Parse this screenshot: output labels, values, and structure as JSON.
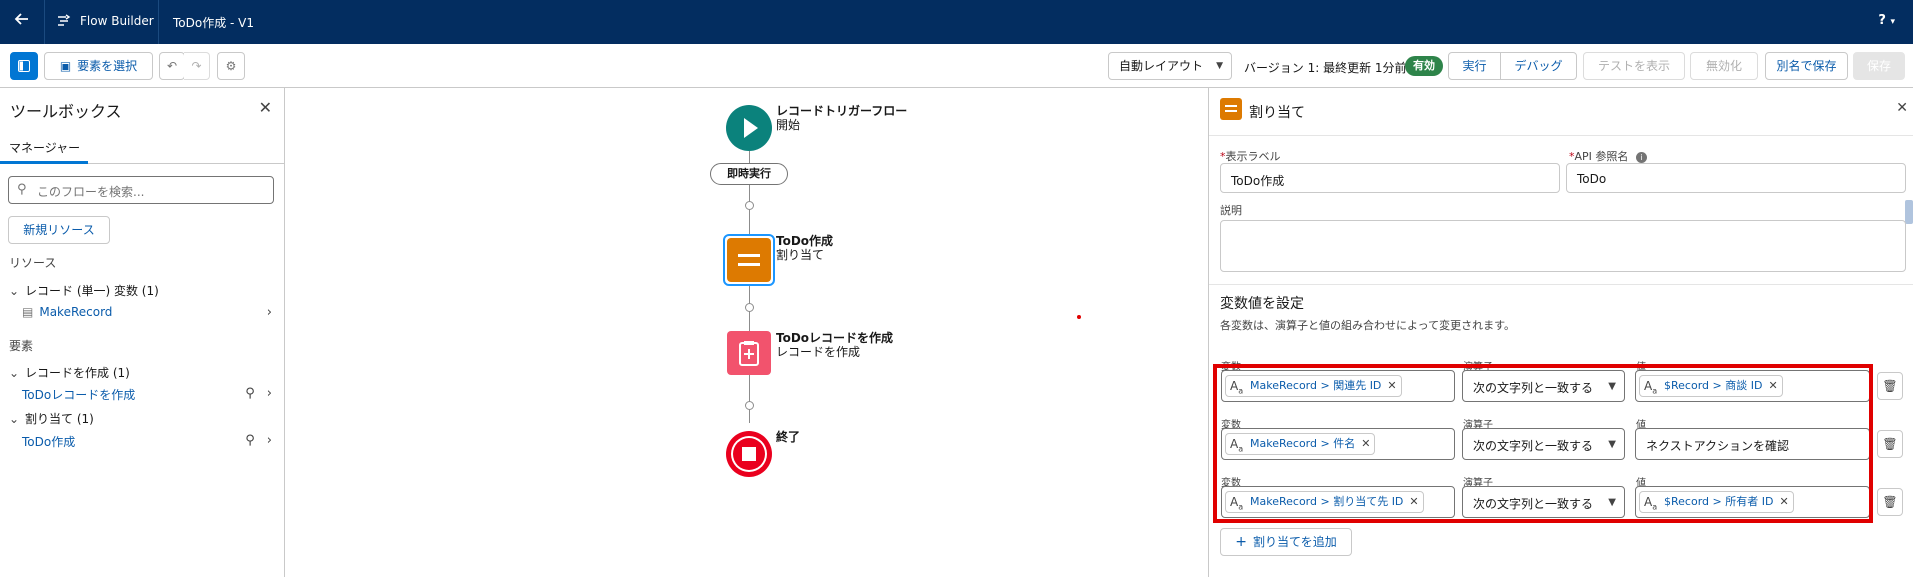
{
  "header": {
    "back_icon": "back-arrow-icon",
    "app_icon": "flow-builder-icon",
    "app_title": "Flow Builder",
    "flow_name": "ToDo作成 - V1",
    "help": "?",
    "help_caret": "▾"
  },
  "toolbar": {
    "select_elements": "要素を選択",
    "layout_select": "自動レイアウト",
    "version_text": "バージョン 1: 最終更新 1分前",
    "status_badge": "有効",
    "run": "実行",
    "debug": "デバッグ",
    "view_tests": "テストを表示",
    "deactivate": "無効化",
    "save_as": "別名で保存",
    "save": "保存"
  },
  "toolbox": {
    "title": "ツールボックス",
    "tab": "マネージャー",
    "search_placeholder": "このフローを検索...",
    "new_resource": "新規リソース",
    "resources_heading": "リソース",
    "record_var_group": "レコード (単一) 変数 (1)",
    "record_var_item": "MakeRecord",
    "elements_heading": "要素",
    "create_group": "レコードを作成 (1)",
    "create_item": "ToDoレコードを作成",
    "assign_group": "割り当て (1)",
    "assign_item": "ToDo作成"
  },
  "canvas": {
    "start_title": "レコードトリガーフロー",
    "start_sub": "開始",
    "run_immediately": "即時実行",
    "assign_title": "ToDo作成",
    "assign_sub": "割り当て",
    "create_title": "ToDoレコードを作成",
    "create_sub": "レコードを作成",
    "end_title": "終了"
  },
  "panel": {
    "title": "割り当て",
    "label_caption": "表示ラベル",
    "label_value": "ToDo作成",
    "api_caption": "API 参照名",
    "api_value": "ToDo",
    "desc_caption": "説明",
    "section_title": "変数値を設定",
    "section_help": "各変数は、演算子と値の組み合わせによって変更されます。",
    "col_variable": "変数",
    "col_operator": "演算子",
    "col_value": "値",
    "rows": [
      {
        "variable": "MakeRecord > 関連先 ID",
        "operator": "次の文字列と一致する",
        "value": "$Record > 商談 ID",
        "value_is_chip": true
      },
      {
        "variable": "MakeRecord > 件名",
        "operator": "次の文字列と一致する",
        "value": "ネクストアクションを確認",
        "value_is_chip": false
      },
      {
        "variable": "MakeRecord > 割り当て先 ID",
        "operator": "次の文字列と一致する",
        "value": "$Record > 所有者 ID",
        "value_is_chip": true
      }
    ],
    "add_assignment": "割り当てを追加"
  },
  "colors": {
    "header_bg": "#032d60",
    "brand": "#0176d3",
    "start_node": "#0b827c",
    "assign_node": "#dd7a01",
    "create_node": "#f2536d",
    "end_node": "#ea001e",
    "active_badge": "#2e844a",
    "highlight": "#e00000"
  }
}
